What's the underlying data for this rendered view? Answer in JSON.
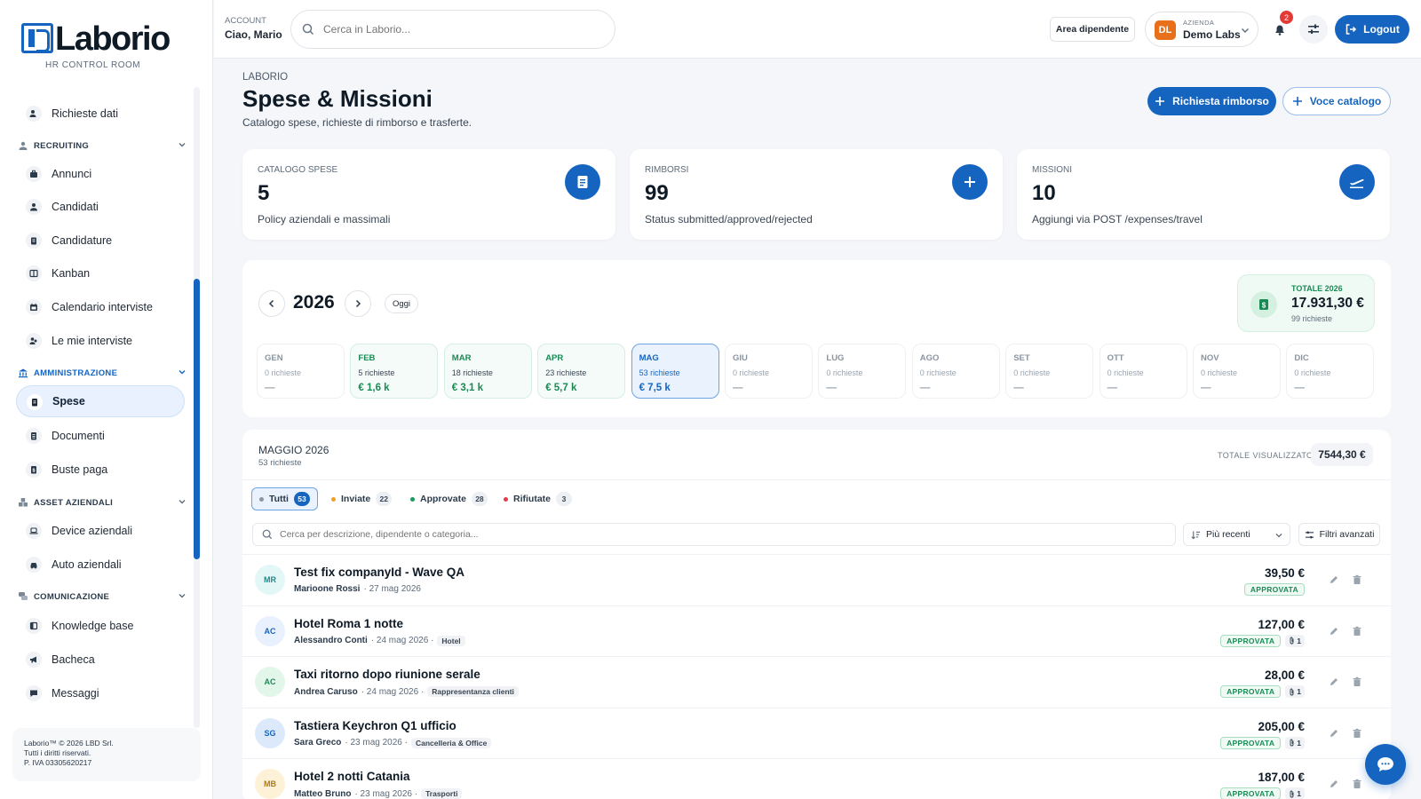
{
  "brand": {
    "name": "Laborio",
    "subtitle": "HR CONTROL ROOM",
    "accent": "#1565c0"
  },
  "sidebar": {
    "items_top": [
      {
        "label": "Richieste dati",
        "icon": "user-data-icon"
      }
    ],
    "sections": [
      {
        "label": "RECRUITING",
        "items": [
          {
            "label": "Annunci",
            "icon": "briefcase-icon"
          },
          {
            "label": "Candidati",
            "icon": "user-icon"
          },
          {
            "label": "Candidature",
            "icon": "clipboard-icon"
          },
          {
            "label": "Kanban",
            "icon": "columns-icon"
          },
          {
            "label": "Calendario interviste",
            "icon": "calendar-icon"
          },
          {
            "label": "Le mie interviste",
            "icon": "users-icon"
          }
        ]
      },
      {
        "label": "AMMINISTRAZIONE",
        "items": [
          {
            "label": "Spese",
            "icon": "receipt-icon",
            "active": true
          },
          {
            "label": "Documenti",
            "icon": "document-icon"
          },
          {
            "label": "Buste paga",
            "icon": "payslip-icon"
          }
        ]
      },
      {
        "label": "ASSET AZIENDALI",
        "items": [
          {
            "label": "Device aziendali",
            "icon": "laptop-icon"
          },
          {
            "label": "Auto aziendali",
            "icon": "car-icon"
          }
        ]
      },
      {
        "label": "COMUNICAZIONE",
        "items": [
          {
            "label": "Knowledge base",
            "icon": "book-icon"
          },
          {
            "label": "Bacheca",
            "icon": "megaphone-icon"
          },
          {
            "label": "Messaggi",
            "icon": "chat-icon"
          }
        ]
      }
    ],
    "footer": {
      "line1": "Laborio™ © 2026 LBD Srl.",
      "line2": "Tutti i diritti riservati.",
      "line3": "P. IVA 03305620217"
    }
  },
  "header": {
    "account_label": "ACCOUNT",
    "account_name": "Ciao, Mario",
    "search_placeholder": "Cerca in Laborio...",
    "area_button": "Area dipendente",
    "company": {
      "label": "AZIENDA",
      "name": "Demo Labs",
      "initials": "DL"
    },
    "notifications_count": "2",
    "logout": "Logout"
  },
  "page": {
    "breadcrumb": "LABORIO",
    "title": "Spese & Missioni",
    "subtitle": "Catalogo spese, richieste di rimborso e trasferte.",
    "primary_button": "Richiesta rimborso",
    "secondary_button": "Voce catalogo"
  },
  "stats": [
    {
      "label": "CATALOGO SPESE",
      "value": "5",
      "desc": "Policy aziendali e massimali",
      "icon": "document-icon"
    },
    {
      "label": "RIMBORSI",
      "value": "99",
      "desc": "Status submitted/approved/rejected",
      "icon": "plus-icon"
    },
    {
      "label": "MISSIONI",
      "value": "10",
      "desc": "Aggiungi via POST /expenses/travel",
      "icon": "plane-icon"
    }
  ],
  "year_panel": {
    "year": "2026",
    "today_button": "Oggi",
    "total_label": "TOTALE 2026",
    "total_value": "17.931,30 €",
    "total_count": "99 richieste",
    "months": [
      {
        "name": "GEN",
        "count": "0 richieste",
        "amount": "—",
        "state": "empty"
      },
      {
        "name": "FEB",
        "count": "5 richieste",
        "amount": "€ 1,6 k",
        "state": "has"
      },
      {
        "name": "MAR",
        "count": "18 richieste",
        "amount": "€ 3,1 k",
        "state": "has"
      },
      {
        "name": "APR",
        "count": "23 richieste",
        "amount": "€ 5,7 k",
        "state": "has"
      },
      {
        "name": "MAG",
        "count": "53 richieste",
        "amount": "€ 7,5 k",
        "state": "sel"
      },
      {
        "name": "GIU",
        "count": "0 richieste",
        "amount": "—",
        "state": "empty"
      },
      {
        "name": "LUG",
        "count": "0 richieste",
        "amount": "—",
        "state": "empty"
      },
      {
        "name": "AGO",
        "count": "0 richieste",
        "amount": "—",
        "state": "empty"
      },
      {
        "name": "SET",
        "count": "0 richieste",
        "amount": "—",
        "state": "empty"
      },
      {
        "name": "OTT",
        "count": "0 richieste",
        "amount": "—",
        "state": "empty"
      },
      {
        "name": "NOV",
        "count": "0 richieste",
        "amount": "—",
        "state": "empty"
      },
      {
        "name": "DIC",
        "count": "0 richieste",
        "amount": "—",
        "state": "empty"
      }
    ]
  },
  "list": {
    "title": "MAGGIO 2026",
    "subtitle": "53 richieste",
    "total_label": "TOTALE VISUALIZZATO",
    "total_value": "7544,30 €",
    "filters": [
      {
        "label": "Tutti",
        "count": "53",
        "color": "#8a95a1",
        "active": true
      },
      {
        "label": "Inviate",
        "count": "22",
        "color": "#f0a020"
      },
      {
        "label": "Approvate",
        "count": "28",
        "color": "#1a9a5e"
      },
      {
        "label": "Rifiutate",
        "count": "3",
        "color": "#e53950"
      }
    ],
    "search_placeholder": "Cerca per descrizione, dipendente o categoria...",
    "sort_label": "Più recenti",
    "advanced_filters": "Filtri avanzati",
    "rows": [
      {
        "initials": "MR",
        "avatar_bg": "#e3f7f7",
        "avatar_fg": "#1e8a8a",
        "title": "Test fix companyId - Wave QA",
        "who": "Marioone Rossi",
        "date": "· 27 mag 2026",
        "tag": "",
        "amount": "39,50 €",
        "status": "APPROVATA",
        "attachments": ""
      },
      {
        "initials": "AC",
        "avatar_bg": "#e8f1fd",
        "avatar_fg": "#1565c0",
        "title": "Hotel Roma 1 notte",
        "who": "Alessandro Conti",
        "date": "· 24 mag 2026 ·",
        "tag": "Hotel",
        "amount": "127,00 €",
        "status": "APPROVATA",
        "attachments": "1"
      },
      {
        "initials": "AC",
        "avatar_bg": "#e3f6ea",
        "avatar_fg": "#1a8a55",
        "title": "Taxi ritorno dopo riunione serale",
        "who": "Andrea Caruso",
        "date": "· 24 mag 2026 ·",
        "tag": "Rappresentanza clienti",
        "amount": "28,00 €",
        "status": "APPROVATA",
        "attachments": "1"
      },
      {
        "initials": "SG",
        "avatar_bg": "#dce9fb",
        "avatar_fg": "#1565c0",
        "title": "Tastiera Keychron Q1 ufficio",
        "who": "Sara Greco",
        "date": "· 23 mag 2026 ·",
        "tag": "Cancelleria & Office",
        "amount": "205,00 €",
        "status": "APPROVATA",
        "attachments": "1"
      },
      {
        "initials": "MB",
        "avatar_bg": "#fdf1d8",
        "avatar_fg": "#b07a10",
        "title": "Hotel 2 notti Catania",
        "who": "Matteo Bruno",
        "date": "· 23 mag 2026 ·",
        "tag": "Trasporti",
        "amount": "187,00 €",
        "status": "APPROVATA",
        "attachments": "1"
      }
    ]
  }
}
